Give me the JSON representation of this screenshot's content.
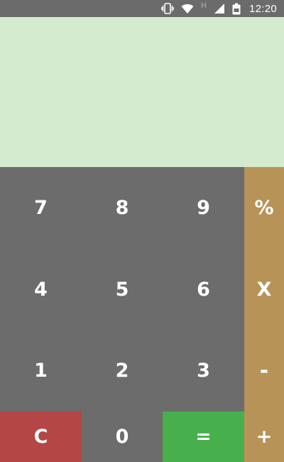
{
  "status_bar": {
    "time": "12:20",
    "network_letter": "H",
    "icons": [
      "vibrate-icon",
      "wifi-icon",
      "network-type-icon",
      "cell-signal-icon",
      "battery-icon"
    ]
  },
  "display": {
    "value": ""
  },
  "keys": {
    "row1": [
      "7",
      "8",
      "9",
      "%"
    ],
    "row2": [
      "4",
      "5",
      "6",
      "X"
    ],
    "row3": [
      "1",
      "2",
      "3",
      "-"
    ],
    "row4": [
      "C",
      "0",
      "=",
      "+"
    ]
  },
  "colors": {
    "display_bg": "#d5ebcf",
    "keypad_bg": "#6c6c6c",
    "operator_bg": "#b89358",
    "clear_bg": "#b44646",
    "equals_bg": "#47af4b",
    "status_bar_bg": "#6b6b6b"
  }
}
